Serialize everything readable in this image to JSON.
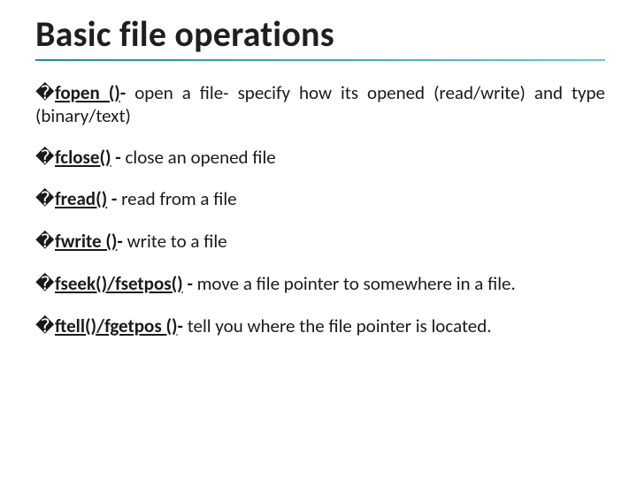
{
  "title": "Basic file operations",
  "bullet_glyph": "�",
  "items": [
    {
      "fn": "fopen ()",
      "sep": "- ",
      "desc": "open a file- specify how its opened (read/write) and type (binary/text)"
    },
    {
      "fn": "fclose()",
      "sep": " - ",
      "desc": "close an opened file"
    },
    {
      "fn": "fread()",
      "sep": " - ",
      "desc": "read from a file"
    },
    {
      "fn": "fwrite ()",
      "sep": "- ",
      "desc": "write to a file"
    },
    {
      "fn": "fseek()/fsetpos()",
      "sep": " - ",
      "desc": "move a file pointer to somewhere in a file."
    },
    {
      "fn": "ftell()/fgetpos ()",
      "sep": "- ",
      "desc": "tell you where the file pointer is located."
    }
  ]
}
